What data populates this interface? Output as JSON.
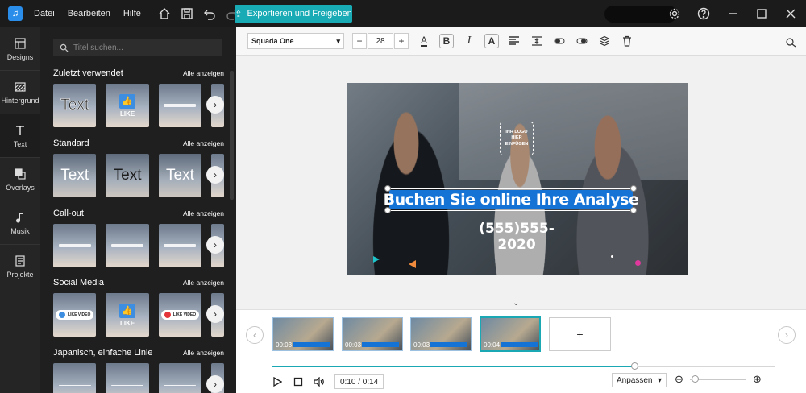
{
  "menu": [
    "Datei",
    "Bearbeiten",
    "Hilfe"
  ],
  "export_label": "Exportieren und Freigeben",
  "rail": [
    {
      "label": "Designs",
      "icon": "designs-icon"
    },
    {
      "label": "Hintergrund",
      "icon": "background-icon"
    },
    {
      "label": "Text",
      "icon": "text-icon"
    },
    {
      "label": "Overlays",
      "icon": "overlays-icon"
    },
    {
      "label": "Musik",
      "icon": "music-icon"
    },
    {
      "label": "Projekte",
      "icon": "projects-icon"
    }
  ],
  "panel": {
    "search_placeholder": "Titel suchen...",
    "show_all": "Alle anzeigen",
    "sections": [
      {
        "title": "Zuletzt verwendet"
      },
      {
        "title": "Standard"
      },
      {
        "title": "Call-out"
      },
      {
        "title": "Social Media"
      },
      {
        "title": "Japanisch, einfache Linie"
      }
    ],
    "thumb_text": "Text",
    "like_label": "LIKE",
    "like_video": "LIKE VIDEO"
  },
  "toolbar": {
    "font": "Squada One",
    "size": "28"
  },
  "canvas": {
    "logo_text": "IHR LOGO HIER EINFÜGEN",
    "headline": "Buchen Sie online Ihre Analyse",
    "phone": "(555)555-2020"
  },
  "timeline": {
    "clips": [
      "00:03",
      "00:03",
      "00:03",
      "00:04"
    ],
    "current_time": "0:10 / 0:14",
    "fit": "Anpassen",
    "progress": 0.72,
    "add": "+"
  }
}
